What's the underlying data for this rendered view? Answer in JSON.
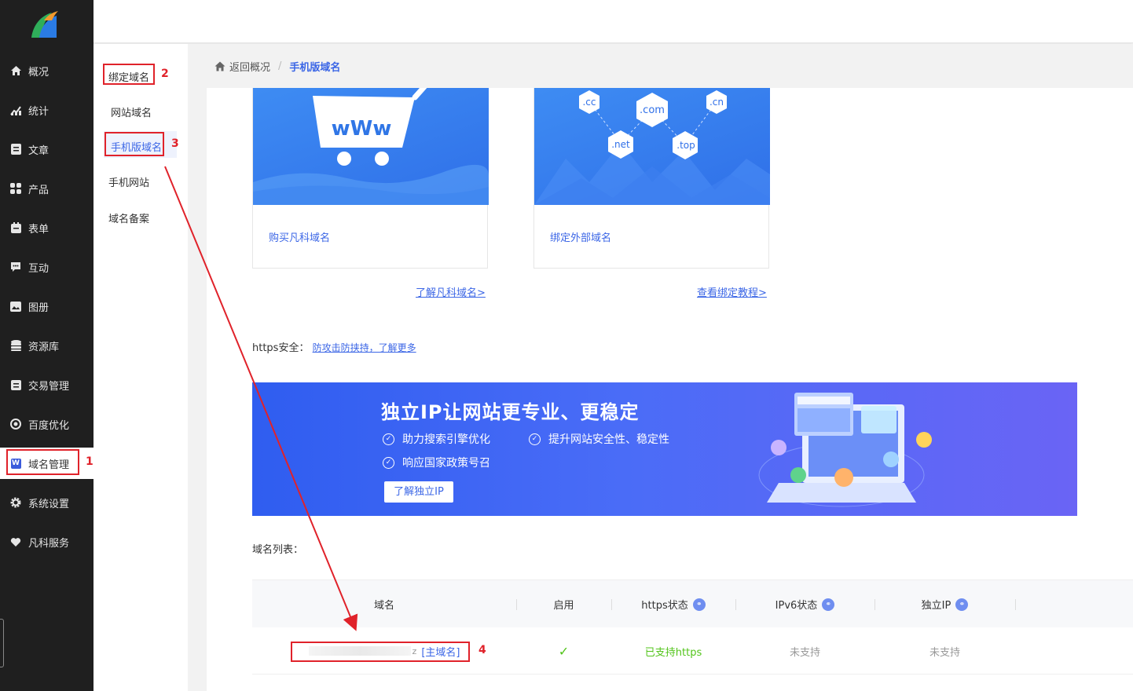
{
  "sidebar": {
    "items": [
      {
        "label": "概况",
        "icon": "home-icon"
      },
      {
        "label": "统计",
        "icon": "chart-icon"
      },
      {
        "label": "文章",
        "icon": "article-icon"
      },
      {
        "label": "产品",
        "icon": "grid-icon"
      },
      {
        "label": "表单",
        "icon": "form-icon"
      },
      {
        "label": "互动",
        "icon": "chat-icon"
      },
      {
        "label": "图册",
        "icon": "album-icon"
      },
      {
        "label": "资源库",
        "icon": "database-icon"
      },
      {
        "label": "交易管理",
        "icon": "order-icon"
      },
      {
        "label": "百度优化",
        "icon": "seo-icon"
      },
      {
        "label": "域名管理",
        "icon": "w-icon"
      },
      {
        "label": "系统设置",
        "icon": "gear-icon"
      },
      {
        "label": "凡科服务",
        "icon": "heart-icon"
      }
    ],
    "active_index": 10
  },
  "subnav": {
    "items": [
      "绑定域名",
      "网站域名",
      "手机版域名",
      "手机网站",
      "域名备案"
    ],
    "active": "手机版域名"
  },
  "breadcrumb": {
    "back": "返回概况",
    "current": "手机版域名"
  },
  "cards": [
    {
      "label": "购买凡科域名",
      "image_text": "wWw"
    },
    {
      "label": "绑定外部域名",
      "tags": [
        ".cc",
        ".com",
        ".cn",
        ".net",
        ".top"
      ]
    }
  ],
  "links": {
    "learn_domain": "了解凡科域名>",
    "bind_tutorial": "查看绑定教程>"
  },
  "https": {
    "label": "https安全：",
    "link": "防攻击防挟持，了解更多"
  },
  "banner": {
    "title": "独立IP让网站更专业、更稳定",
    "features": [
      "助力搜索引擎优化",
      "提升网站安全性、稳定性",
      "响应国家政策号召"
    ],
    "button": "了解独立IP"
  },
  "domain_list": {
    "title": "域名列表：",
    "columns": [
      "域名",
      "启用",
      "https状态",
      "IPv6状态",
      "独立IP"
    ],
    "rows": [
      {
        "domain_suffix": "z",
        "tag": "[主域名]",
        "enabled": "✓",
        "https": "已支持https",
        "ipv6": "未支持",
        "dedicated_ip": "未支持"
      }
    ]
  },
  "annotations": [
    "1",
    "2",
    "3",
    "4"
  ],
  "colors": {
    "accent": "#3b66e6",
    "annotation": "#e0222a",
    "sidebar_bg": "#1f1f1f",
    "success": "#52c41a"
  }
}
